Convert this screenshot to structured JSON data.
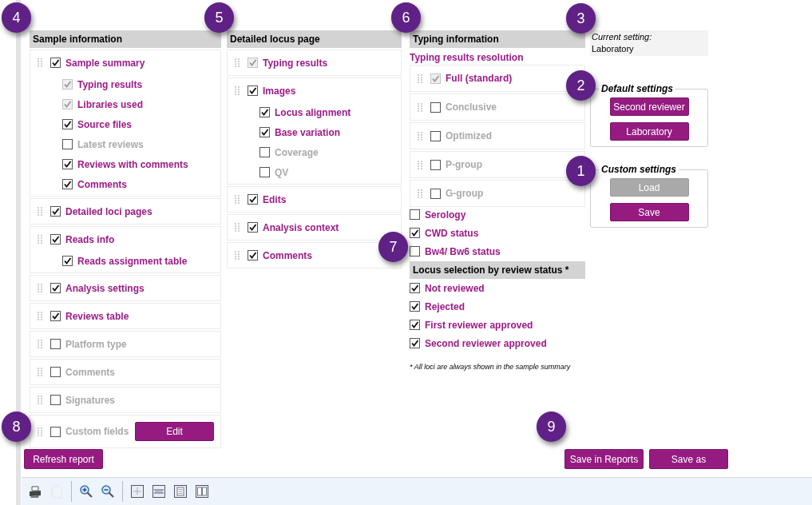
{
  "callouts": [
    {
      "label": "4"
    },
    {
      "label": "5"
    },
    {
      "label": "6"
    },
    {
      "label": "3"
    },
    {
      "label": "2"
    },
    {
      "label": "1"
    },
    {
      "label": "7"
    },
    {
      "label": "8"
    },
    {
      "label": "9"
    }
  ],
  "sample_information": {
    "title": "Sample information",
    "items": [
      {
        "label": "Sample summary",
        "checked": true,
        "locked": false,
        "muted": false,
        "children": [
          {
            "label": "Typing results",
            "checked": true,
            "locked": true,
            "muted": false
          },
          {
            "label": "Libraries used",
            "checked": true,
            "locked": true,
            "muted": false
          },
          {
            "label": "Source files",
            "checked": true,
            "locked": false,
            "muted": false
          },
          {
            "label": "Latest reviews",
            "checked": false,
            "locked": false,
            "muted": true
          },
          {
            "label": "Reviews with comments",
            "checked": true,
            "locked": false,
            "muted": false
          },
          {
            "label": "Comments",
            "checked": true,
            "locked": false,
            "muted": false
          }
        ]
      },
      {
        "label": "Detailed loci pages",
        "checked": true,
        "locked": false,
        "muted": false
      },
      {
        "label": "Reads info",
        "checked": true,
        "locked": false,
        "muted": false,
        "children": [
          {
            "label": "Reads assignment table",
            "checked": true,
            "locked": false,
            "muted": false
          }
        ]
      },
      {
        "label": "Analysis settings",
        "checked": true,
        "locked": false,
        "muted": false
      },
      {
        "label": "Reviews table",
        "checked": true,
        "locked": false,
        "muted": false
      },
      {
        "label": "Platform type",
        "checked": false,
        "locked": false,
        "muted": true
      },
      {
        "label": "Comments",
        "checked": false,
        "locked": false,
        "muted": true
      },
      {
        "label": "Signatures",
        "checked": false,
        "locked": false,
        "muted": true
      },
      {
        "label": "Custom fields",
        "checked": false,
        "locked": false,
        "muted": true,
        "button": "Edit"
      }
    ]
  },
  "detailed_locus_page": {
    "title": "Detailed locus page",
    "items": [
      {
        "label": "Typing results",
        "checked": true,
        "locked": true,
        "muted": false
      },
      {
        "label": "Images",
        "checked": true,
        "locked": false,
        "muted": false,
        "children": [
          {
            "label": "Locus alignment",
            "checked": true,
            "locked": false,
            "muted": false
          },
          {
            "label": "Base variation",
            "checked": true,
            "locked": false,
            "muted": false
          },
          {
            "label": "Coverage",
            "checked": false,
            "locked": false,
            "muted": true
          },
          {
            "label": "QV",
            "checked": false,
            "locked": false,
            "muted": true
          }
        ]
      },
      {
        "label": "Edits",
        "checked": true,
        "locked": false,
        "muted": false
      },
      {
        "label": "Analysis context",
        "checked": true,
        "locked": false,
        "muted": false
      },
      {
        "label": "Comments",
        "checked": true,
        "locked": false,
        "muted": false
      }
    ]
  },
  "typing_information": {
    "title": "Typing information",
    "resolution_label": "Typing results resolution",
    "resolution_options": [
      {
        "label": "Full (standard)",
        "checked": true,
        "locked": true,
        "muted": false
      },
      {
        "label": "Conclusive",
        "checked": false,
        "locked": false,
        "muted": true
      },
      {
        "label": "Optimized",
        "checked": false,
        "locked": false,
        "muted": true
      },
      {
        "label": "P-group",
        "checked": false,
        "locked": false,
        "muted": true
      },
      {
        "label": "G-group",
        "checked": false,
        "locked": false,
        "muted": true
      }
    ],
    "options": [
      {
        "label": "Serology",
        "checked": false,
        "locked": false,
        "muted": false
      },
      {
        "label": "CWD status",
        "checked": true,
        "locked": false,
        "muted": false
      },
      {
        "label": "Bw4/ Bw6 status",
        "checked": false,
        "locked": false,
        "muted": false
      }
    ]
  },
  "locus_selection": {
    "title": "Locus selection by review status *",
    "options": [
      {
        "label": "Not reviewed",
        "checked": true,
        "locked": false,
        "muted": false
      },
      {
        "label": "Rejected",
        "checked": true,
        "locked": false,
        "muted": false
      },
      {
        "label": "First reviewer approved",
        "checked": true,
        "locked": false,
        "muted": false
      },
      {
        "label": "Second reviewer approved",
        "checked": true,
        "locked": false,
        "muted": false
      }
    ],
    "footnote": "* All loci are always shown in the sample summary"
  },
  "current_setting": {
    "label": "Current setting:",
    "value": "Laboratory"
  },
  "default_settings": {
    "title": "Default settings",
    "buttons": [
      {
        "label": "Second reviewer",
        "disabled": false
      },
      {
        "label": "Laboratory",
        "disabled": false
      }
    ]
  },
  "custom_settings": {
    "title": "Custom settings",
    "buttons": [
      {
        "label": "Load",
        "disabled": true
      },
      {
        "label": "Save",
        "disabled": false
      }
    ]
  },
  "refresh_button": "Refresh report",
  "save_buttons": [
    "Save in Reports",
    "Save as"
  ],
  "toolbar": {
    "items": [
      {
        "kind": "print",
        "disabled": false
      },
      {
        "kind": "copy",
        "disabled": true
      },
      {
        "kind": "separator"
      },
      {
        "kind": "zoom-in",
        "disabled": false
      },
      {
        "kind": "zoom-out",
        "disabled": false
      },
      {
        "kind": "separator"
      },
      {
        "kind": "fit-page",
        "disabled": false
      },
      {
        "kind": "page-width",
        "disabled": false
      },
      {
        "kind": "single-page",
        "disabled": false
      },
      {
        "kind": "two-pages",
        "disabled": false
      }
    ]
  }
}
